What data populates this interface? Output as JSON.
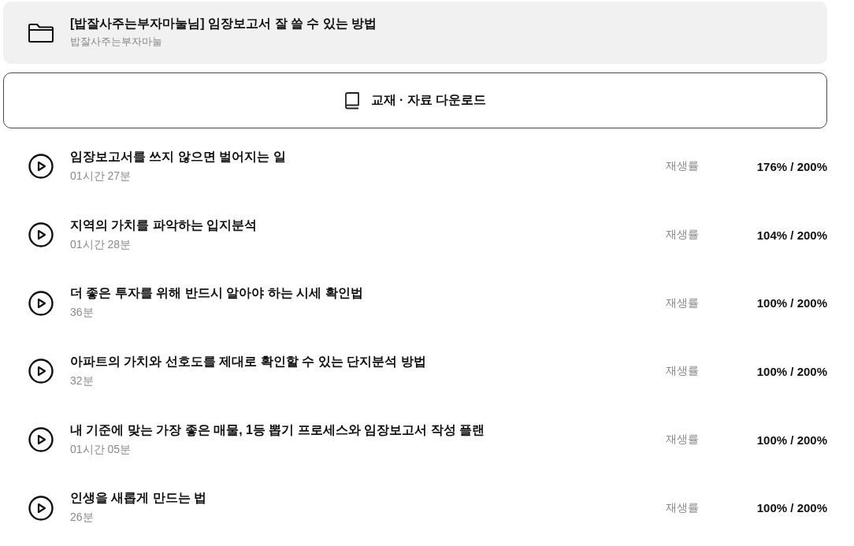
{
  "course": {
    "title": "[밥잘사주는부자마눌님] 임장보고서 잘 쓸 수 있는 방법",
    "instructor": "밥잘사주는부자마눌"
  },
  "download_button": {
    "label": "교재 · 자료 다운로드"
  },
  "lectures": [
    {
      "title": "임장보고서를 쓰지 않으면 벌어지는 일",
      "duration": "01시간 27분",
      "progress_label": "재생률",
      "progress": "176% / 200%"
    },
    {
      "title": "지역의 가치를 파악하는 입지분석",
      "duration": "01시간 28분",
      "progress_label": "재생률",
      "progress": "104% / 200%"
    },
    {
      "title": "더 좋은 투자를 위해 반드시 알아야 하는 시세 확인법",
      "duration": "36분",
      "progress_label": "재생률",
      "progress": "100% / 200%"
    },
    {
      "title": "아파트의 가치와 선호도를 제대로 확인할 수 있는 단지분석 방법",
      "duration": "32분",
      "progress_label": "재생률",
      "progress": "100% / 200%"
    },
    {
      "title": "내 기준에 맞는 가장 좋은 매물, 1등 뽑기 프로세스와 임장보고서 작성 플랜",
      "duration": "01시간 05분",
      "progress_label": "재생률",
      "progress": "100% / 200%"
    },
    {
      "title": "인생을 새롭게 만드는 법",
      "duration": "26분",
      "progress_label": "재생률",
      "progress": "100% / 200%"
    }
  ]
}
